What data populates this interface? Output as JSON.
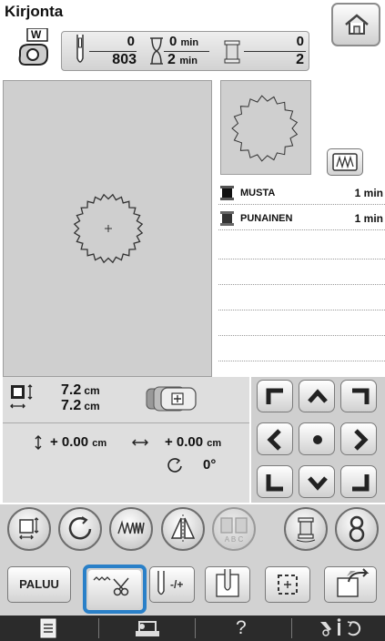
{
  "title": "Kirjonta",
  "presser_foot": {
    "letter": "W"
  },
  "status": {
    "stitch_current": "0",
    "stitch_total": "803",
    "time_current": "0",
    "time_total": "2",
    "time_unit": "min",
    "color_current": "0",
    "color_total": "2"
  },
  "colors": [
    {
      "name": "MUSTA",
      "time": "1 min",
      "swatch": "#1a1a1a"
    },
    {
      "name": "PUNAINEN",
      "time": "1 min",
      "swatch": "#3a3a3a"
    }
  ],
  "size": {
    "width": "7.2",
    "height": "7.2",
    "unit": "cm"
  },
  "position": {
    "y": "+ 0.00",
    "x": "+ 0.00",
    "unit": "cm"
  },
  "rotation": {
    "value": "0°"
  },
  "buttons": {
    "back_label": "PALUU",
    "needle_label": "-/+"
  },
  "footer": {
    "help_label": "?",
    "icons": [
      "document-icon",
      "machine-icon",
      "help-icon",
      "settings-icon"
    ]
  },
  "accent_color": "#2a80c8"
}
